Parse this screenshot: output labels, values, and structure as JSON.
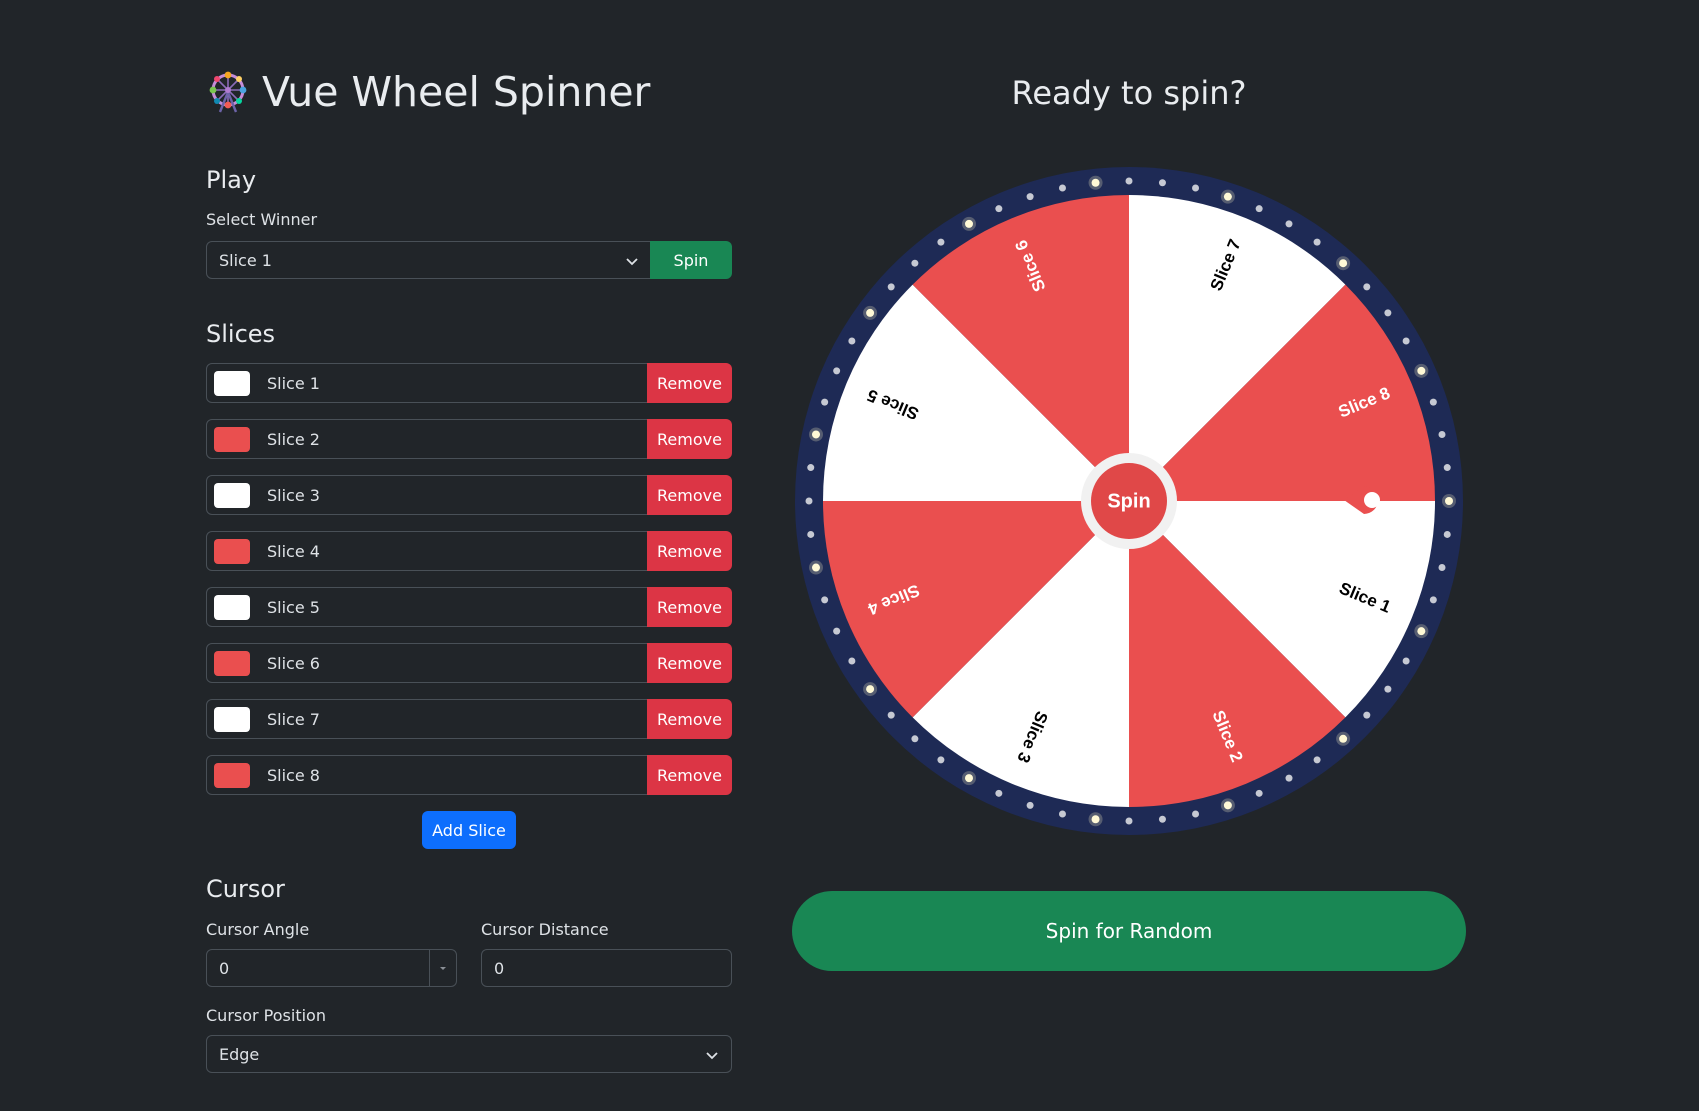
{
  "app": {
    "title": "Vue Wheel Spinner",
    "icon": "ferris-wheel-icon"
  },
  "play": {
    "heading": "Play",
    "select_label": "Select Winner",
    "selected_winner": "Slice 1",
    "spin_label": "Spin"
  },
  "slices": {
    "heading": "Slices",
    "remove_label": "Remove",
    "add_label": "Add Slice",
    "items": [
      {
        "label": "Slice 1",
        "color": "#ffffff"
      },
      {
        "label": "Slice 2",
        "color": "#ea4f4f"
      },
      {
        "label": "Slice 3",
        "color": "#ffffff"
      },
      {
        "label": "Slice 4",
        "color": "#ea4f4f"
      },
      {
        "label": "Slice 5",
        "color": "#ffffff"
      },
      {
        "label": "Slice 6",
        "color": "#ea4f4f"
      },
      {
        "label": "Slice 7",
        "color": "#ffffff"
      },
      {
        "label": "Slice 8",
        "color": "#ea4f4f"
      }
    ]
  },
  "cursor": {
    "heading": "Cursor",
    "angle_label": "Cursor Angle",
    "angle_value": "0",
    "distance_label": "Cursor Distance",
    "distance_value": "0",
    "position_label": "Cursor Position",
    "position_value": "Edge"
  },
  "wheel": {
    "status": "Ready to spin?",
    "center_label": "Spin",
    "random_button": "Spin for Random",
    "colors": {
      "red": "#ea4f4f",
      "white": "#ffffff",
      "rim": "#1e2a55",
      "center": "#e04848"
    },
    "slices": [
      {
        "label": "Slice 1",
        "fill": "#ffffff",
        "text_color": "#000000"
      },
      {
        "label": "Slice 2",
        "fill": "#ea4f4f",
        "text_color": "#ffffff"
      },
      {
        "label": "Slice 3",
        "fill": "#ffffff",
        "text_color": "#000000"
      },
      {
        "label": "Slice 4",
        "fill": "#ea4f4f",
        "text_color": "#ffffff"
      },
      {
        "label": "Slice 5",
        "fill": "#ffffff",
        "text_color": "#000000"
      },
      {
        "label": "Slice 6",
        "fill": "#ea4f4f",
        "text_color": "#ffffff"
      },
      {
        "label": "Slice 7",
        "fill": "#ffffff",
        "text_color": "#000000"
      },
      {
        "label": "Slice 8",
        "fill": "#ea4f4f",
        "text_color": "#ffffff"
      }
    ]
  }
}
